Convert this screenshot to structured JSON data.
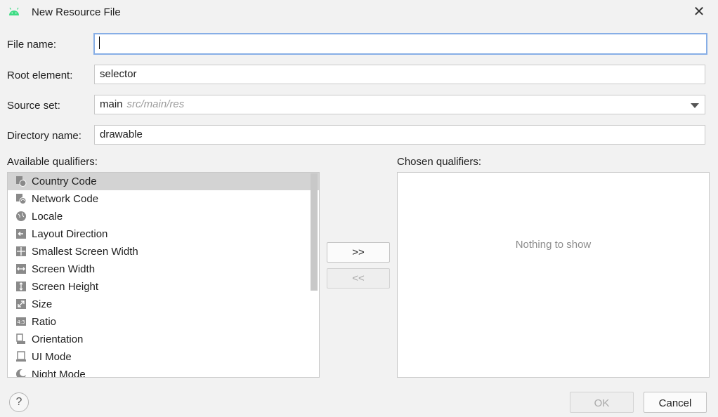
{
  "window": {
    "title": "New Resource File",
    "icon": "android-icon",
    "close_glyph": "✕"
  },
  "form": {
    "file_name": {
      "label": "File name:",
      "value": ""
    },
    "root_element": {
      "label": "Root element:",
      "value": "selector"
    },
    "source_set": {
      "label": "Source set:",
      "value": "main",
      "hint": "src/main/res"
    },
    "directory_name": {
      "label": "Directory name:",
      "value": "drawable"
    }
  },
  "available": {
    "label": "Available qualifiers:",
    "items": [
      {
        "label": "Country Code",
        "icon": "country-code-icon",
        "selected": true
      },
      {
        "label": "Network Code",
        "icon": "network-code-icon"
      },
      {
        "label": "Locale",
        "icon": "globe-icon"
      },
      {
        "label": "Layout Direction",
        "icon": "layout-direction-icon"
      },
      {
        "label": "Smallest Screen Width",
        "icon": "smallest-width-icon"
      },
      {
        "label": "Screen Width",
        "icon": "screen-width-icon"
      },
      {
        "label": "Screen Height",
        "icon": "screen-height-icon"
      },
      {
        "label": "Size",
        "icon": "size-icon"
      },
      {
        "label": "Ratio",
        "icon": "ratio-icon"
      },
      {
        "label": "Orientation",
        "icon": "orientation-icon"
      },
      {
        "label": "UI Mode",
        "icon": "ui-mode-icon"
      },
      {
        "label": "Night Mode",
        "icon": "night-mode-icon"
      }
    ]
  },
  "chosen": {
    "label": "Chosen qualifiers:",
    "empty_text": "Nothing to show"
  },
  "buttons": {
    "add": ">>",
    "remove": "<<",
    "ok": "OK",
    "cancel": "Cancel",
    "help": "?"
  }
}
